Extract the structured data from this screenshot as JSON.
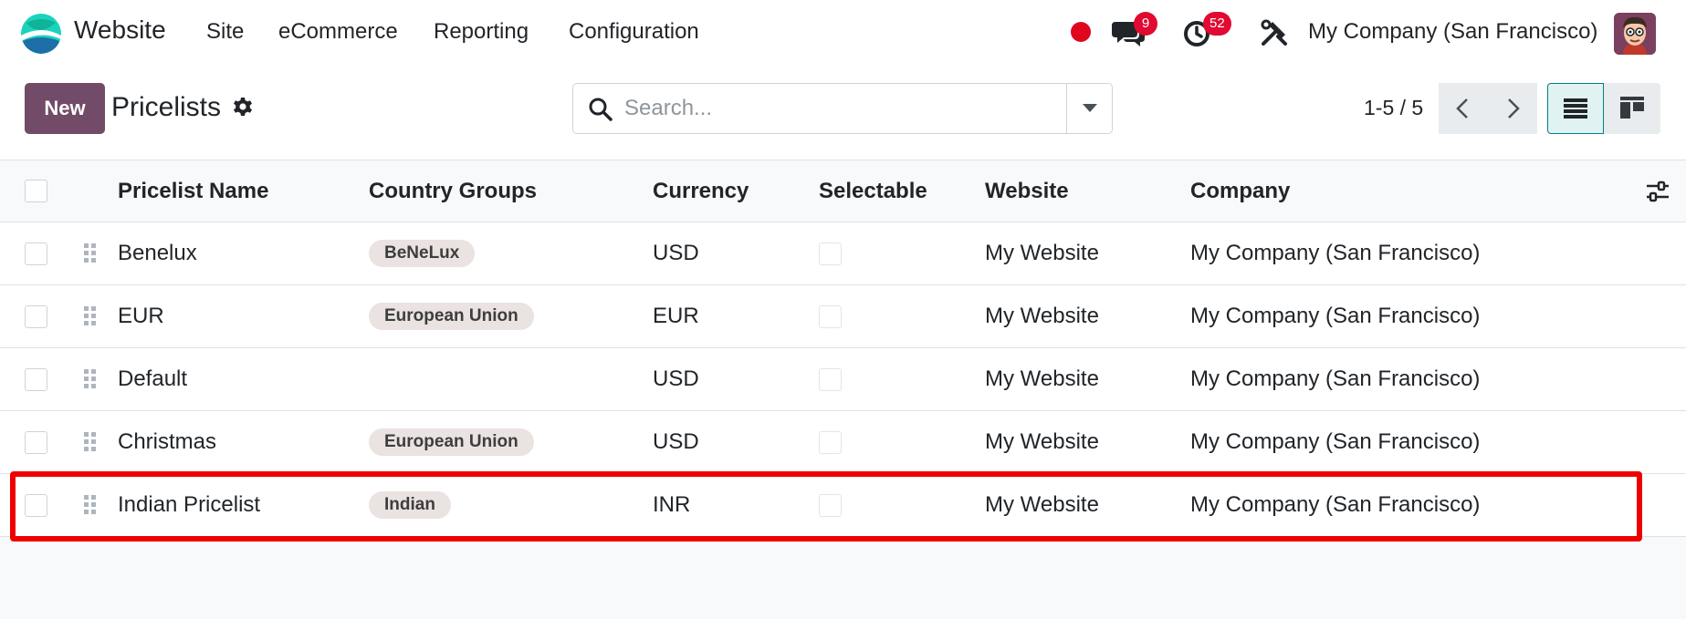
{
  "navbar": {
    "app_name": "Website",
    "menu": [
      "Site",
      "eCommerce",
      "Reporting",
      "Configuration"
    ],
    "messages_count": "9",
    "activities_count": "52",
    "company": "My Company (San Francisco)",
    "colors": {
      "badge": "#e10a32",
      "recording_dot": "#e0061e"
    }
  },
  "control_panel": {
    "new_label": "New",
    "title": "Pricelists",
    "search_placeholder": "Search...",
    "pager": "1-5 / 5",
    "colors": {
      "primary": "#714b67",
      "active_view": "#017e84"
    }
  },
  "table": {
    "columns": [
      "Pricelist Name",
      "Country Groups",
      "Currency",
      "Selectable",
      "Website",
      "Company"
    ],
    "rows": [
      {
        "name": "Benelux",
        "country_group": "BeNeLux",
        "currency": "USD",
        "selectable": false,
        "website": "My Website",
        "company": "My Company (San Francisco)"
      },
      {
        "name": "EUR",
        "country_group": "European Union",
        "currency": "EUR",
        "selectable": false,
        "website": "My Website",
        "company": "My Company (San Francisco)"
      },
      {
        "name": "Default",
        "country_group": "",
        "currency": "USD",
        "selectable": false,
        "website": "My Website",
        "company": "My Company (San Francisco)"
      },
      {
        "name": "Christmas",
        "country_group": "European Union",
        "currency": "USD",
        "selectable": false,
        "website": "My Website",
        "company": "My Company (San Francisco)"
      },
      {
        "name": "Indian Pricelist",
        "country_group": "Indian",
        "currency": "INR",
        "selectable": false,
        "website": "My Website",
        "company": "My Company (San Francisco)"
      }
    ],
    "highlighted_row": 4,
    "highlight_color": "#ee0000"
  }
}
